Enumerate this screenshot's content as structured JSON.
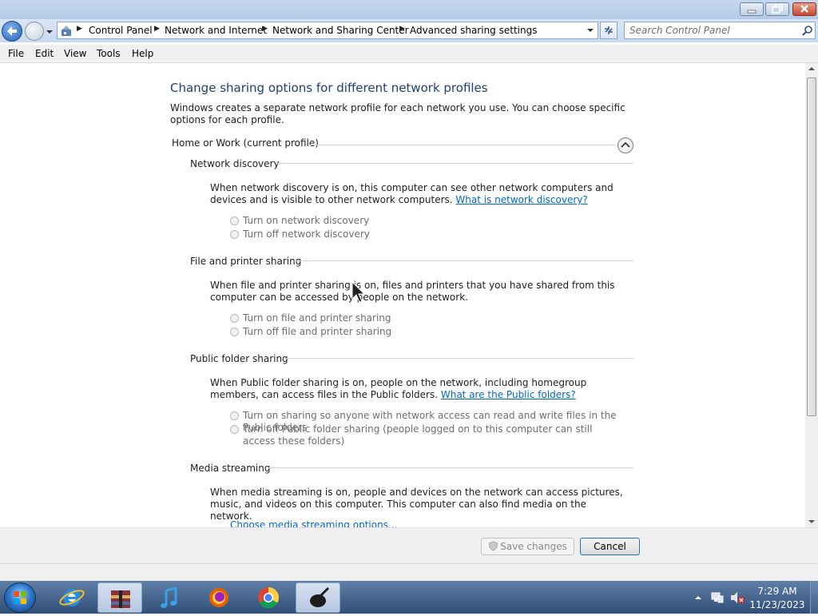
{
  "window": {
    "breadcrumbs": [
      "Control Panel",
      "Network and Internet",
      "Network and Sharing Center",
      "Advanced sharing settings"
    ],
    "search_placeholder": "Search Control Panel"
  },
  "menu": [
    "File",
    "Edit",
    "View",
    "Tools",
    "Help"
  ],
  "page": {
    "title": "Change sharing options for different network profiles",
    "intro": "Windows creates a separate network profile for each network you use. You can choose specific options for each profile.",
    "profile_label": "Home or Work (current profile)"
  },
  "sections": {
    "network_discovery": {
      "heading": "Network discovery",
      "desc": "When network discovery is on, this computer can see other network computers and devices and is visible to other network computers.",
      "link": "What is network discovery?",
      "options": [
        "Turn on network discovery",
        "Turn off network discovery"
      ]
    },
    "file_printer": {
      "heading": "File and printer sharing",
      "desc": "When file and printer sharing is on, files and printers that you have shared from this computer can be accessed by people on the network.",
      "options": [
        "Turn on file and printer sharing",
        "Turn off file and printer sharing"
      ]
    },
    "public_folder": {
      "heading": "Public folder sharing",
      "desc": "When Public folder sharing is on, people on the network, including homegroup members, can access files in the Public folders.",
      "link": "What are the Public folders?",
      "options": [
        "Turn on sharing so anyone with network access can read and write files in the Public folders",
        "Turn off Public folder sharing (people logged on to this computer can still access these folders)"
      ]
    },
    "media_streaming": {
      "heading": "Media streaming",
      "desc": "When media streaming is on, people and devices on the network can access pictures, music, and videos on this computer. This computer can also find media on the network.",
      "link": "Choose media streaming options..."
    }
  },
  "buttons": {
    "save": "Save changes",
    "cancel": "Cancel"
  },
  "taskbar": {
    "time": "7:29 AM",
    "date": "11/23/2023",
    "apps": [
      "internet-explorer-icon",
      "archive-manager-icon",
      "music-player-icon",
      "firefox-icon",
      "chrome-icon",
      "app-icon"
    ]
  }
}
